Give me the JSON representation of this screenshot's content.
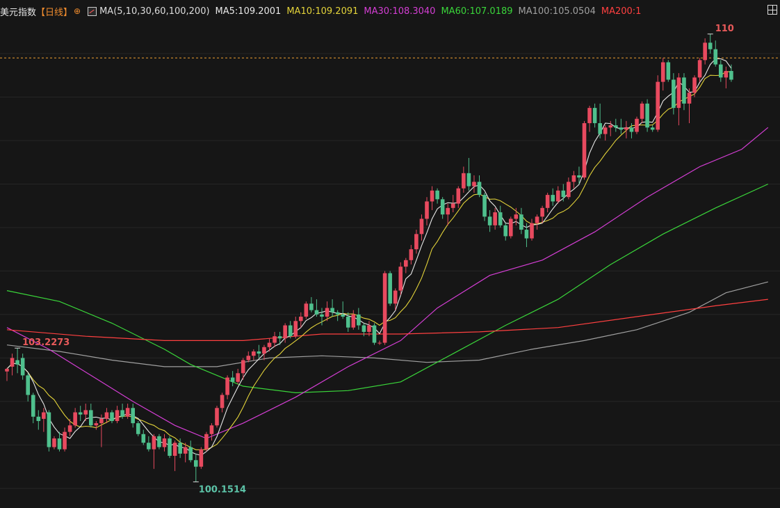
{
  "header": {
    "title": "美元指数",
    "period": "【日线】",
    "period_icon": "⊕",
    "ma_params": "MA(5,10,30,60,100,200)",
    "ma5": "MA5:109.2001",
    "ma10": "MA10:109.2091",
    "ma30": "MA30:108.3040",
    "ma60": "MA60:107.0189",
    "ma100": "MA100:105.0504",
    "ma200": "MA200:1"
  },
  "colors": {
    "background": "#161616",
    "up": "#e84a5f",
    "down": "#4fc08d",
    "ma5": "#e8e8e8",
    "ma10": "#e3d33a",
    "ma30": "#d43ed4",
    "ma60": "#3ad63a",
    "ma100": "#a0a0a0",
    "ma200": "#ff4040",
    "ref_line": "#f0a030"
  },
  "chart_data": {
    "type": "candlestick",
    "title": "美元指数 日线",
    "ylim": [
      99.55,
      110.72
    ],
    "reference_price": 109.9,
    "annotations": [
      {
        "label": "103.2273",
        "value": 103.2273,
        "kind": "high"
      },
      {
        "label": "100.1514",
        "value": 100.1514,
        "kind": "low"
      },
      {
        "label": "110",
        "value": 110.0,
        "kind": "high"
      }
    ],
    "candles": [
      [
        102.69,
        102.77,
        102.47,
        102.75
      ],
      [
        102.8,
        103.1,
        102.6,
        103.0
      ],
      [
        102.95,
        103.2273,
        102.65,
        102.85
      ],
      [
        103.0,
        103.1,
        102.5,
        102.6
      ],
      [
        102.6,
        102.65,
        102.0,
        102.15
      ],
      [
        102.15,
        102.2,
        101.5,
        101.65
      ],
      [
        101.65,
        101.8,
        101.35,
        101.55
      ],
      [
        101.6,
        101.85,
        101.3,
        101.75
      ],
      [
        101.75,
        101.8,
        100.85,
        100.95
      ],
      [
        100.95,
        101.2,
        100.9,
        101.15
      ],
      [
        101.15,
        101.3,
        100.85,
        100.9
      ],
      [
        100.9,
        101.4,
        100.85,
        101.3
      ],
      [
        101.3,
        101.6,
        101.2,
        101.45
      ],
      [
        101.45,
        101.85,
        101.4,
        101.75
      ],
      [
        101.75,
        101.9,
        101.55,
        101.7
      ],
      [
        101.7,
        101.95,
        101.55,
        101.8
      ],
      [
        101.8,
        101.95,
        101.4,
        101.45
      ],
      [
        101.45,
        101.55,
        101.35,
        101.5
      ],
      [
        101.5,
        101.7,
        100.95,
        101.6
      ],
      [
        101.6,
        101.85,
        101.5,
        101.75
      ],
      [
        101.75,
        101.8,
        101.5,
        101.55
      ],
      [
        101.55,
        101.9,
        101.5,
        101.8
      ],
      [
        101.8,
        101.95,
        101.6,
        101.65
      ],
      [
        101.65,
        101.95,
        101.6,
        101.85
      ],
      [
        101.85,
        101.95,
        101.4,
        101.5
      ],
      [
        101.5,
        101.55,
        101.2,
        101.25
      ],
      [
        101.25,
        101.35,
        101.0,
        101.05
      ],
      [
        101.05,
        101.2,
        100.85,
        100.9
      ],
      [
        100.9,
        101.25,
        100.45,
        101.2
      ],
      [
        101.2,
        101.25,
        100.9,
        100.95
      ],
      [
        100.95,
        101.25,
        100.85,
        101.15
      ],
      [
        101.15,
        101.2,
        100.7,
        100.75
      ],
      [
        100.75,
        101.1,
        100.4,
        101.05
      ],
      [
        101.05,
        101.15,
        100.7,
        100.8
      ],
      [
        100.8,
        101.05,
        100.6,
        100.95
      ],
      [
        100.95,
        101.1,
        100.6,
        100.65
      ],
      [
        100.65,
        100.8,
        100.1514,
        100.5
      ],
      [
        100.5,
        100.95,
        100.45,
        100.9
      ],
      [
        100.9,
        101.3,
        100.85,
        101.25
      ],
      [
        101.25,
        101.5,
        101.1,
        101.45
      ],
      [
        101.45,
        101.9,
        101.4,
        101.85
      ],
      [
        101.85,
        102.2,
        101.75,
        102.15
      ],
      [
        102.15,
        102.6,
        102.05,
        102.55
      ],
      [
        102.55,
        102.7,
        102.35,
        102.45
      ],
      [
        102.45,
        102.75,
        102.4,
        102.65
      ],
      [
        102.65,
        103.0,
        102.5,
        102.95
      ],
      [
        102.95,
        103.15,
        102.9,
        103.05
      ],
      [
        103.05,
        103.2,
        102.95,
        103.15
      ],
      [
        103.15,
        103.3,
        103.0,
        103.1
      ],
      [
        103.1,
        103.3,
        102.95,
        103.25
      ],
      [
        103.25,
        103.45,
        103.15,
        103.35
      ],
      [
        103.35,
        103.6,
        103.25,
        103.5
      ],
      [
        103.5,
        103.6,
        103.3,
        103.45
      ],
      [
        103.45,
        103.8,
        103.35,
        103.75
      ],
      [
        103.75,
        103.85,
        103.45,
        103.5
      ],
      [
        103.5,
        103.95,
        103.45,
        103.85
      ],
      [
        103.85,
        104.05,
        103.7,
        103.95
      ],
      [
        103.95,
        104.3,
        103.9,
        104.25
      ],
      [
        104.25,
        104.4,
        104.05,
        104.1
      ],
      [
        104.1,
        104.35,
        103.95,
        104.0
      ],
      [
        104.0,
        104.15,
        103.75,
        103.95
      ],
      [
        103.95,
        104.3,
        103.85,
        104.15
      ],
      [
        104.15,
        104.35,
        103.95,
        104.05
      ],
      [
        104.05,
        104.1,
        103.85,
        104.0
      ],
      [
        104.0,
        104.3,
        103.9,
        103.95
      ],
      [
        103.95,
        104.05,
        103.6,
        103.7
      ],
      [
        103.7,
        104.1,
        103.65,
        104.0
      ],
      [
        104.0,
        104.15,
        103.65,
        103.75
      ],
      [
        103.75,
        103.8,
        103.5,
        103.6
      ],
      [
        103.6,
        103.85,
        103.5,
        103.75
      ],
      [
        103.75,
        103.8,
        103.3,
        103.35
      ],
      [
        103.35,
        103.4,
        103.3,
        103.35
      ],
      [
        103.35,
        105.0,
        103.3,
        104.95
      ],
      [
        104.95,
        105.0,
        104.2,
        104.25
      ],
      [
        104.25,
        104.6,
        104.1,
        104.55
      ],
      [
        104.55,
        105.2,
        104.45,
        105.1
      ],
      [
        105.1,
        105.3,
        104.95,
        105.25
      ],
      [
        105.25,
        105.6,
        105.15,
        105.5
      ],
      [
        105.5,
        105.95,
        105.4,
        105.85
      ],
      [
        105.85,
        106.3,
        105.7,
        106.2
      ],
      [
        106.2,
        106.7,
        106.05,
        106.6
      ],
      [
        106.6,
        106.95,
        106.4,
        106.85
      ],
      [
        106.85,
        106.9,
        106.55,
        106.65
      ],
      [
        106.65,
        106.7,
        106.2,
        106.3
      ],
      [
        106.3,
        106.55,
        106.05,
        106.45
      ],
      [
        106.45,
        106.75,
        106.35,
        106.55
      ],
      [
        106.55,
        106.95,
        106.45,
        106.9
      ],
      [
        106.9,
        107.4,
        106.8,
        107.25
      ],
      [
        107.25,
        107.6,
        106.85,
        106.95
      ],
      [
        106.95,
        107.2,
        106.8,
        107.05
      ],
      [
        107.05,
        107.2,
        106.7,
        106.75
      ],
      [
        106.75,
        106.8,
        106.15,
        106.25
      ],
      [
        106.25,
        106.4,
        105.9,
        106.05
      ],
      [
        106.05,
        106.45,
        105.95,
        106.35
      ],
      [
        106.35,
        106.5,
        106.0,
        106.05
      ],
      [
        106.05,
        106.1,
        105.7,
        105.8
      ],
      [
        105.8,
        106.25,
        105.75,
        106.2
      ],
      [
        106.2,
        106.45,
        106.05,
        106.3
      ],
      [
        106.3,
        106.45,
        105.85,
        105.95
      ],
      [
        105.95,
        106.1,
        105.55,
        105.75
      ],
      [
        105.75,
        106.2,
        105.7,
        106.1
      ],
      [
        106.1,
        106.3,
        105.95,
        106.25
      ],
      [
        106.25,
        106.5,
        106.1,
        106.45
      ],
      [
        106.45,
        106.8,
        106.35,
        106.75
      ],
      [
        106.75,
        106.9,
        106.5,
        106.6
      ],
      [
        106.6,
        106.95,
        106.55,
        106.85
      ],
      [
        106.85,
        107.0,
        106.6,
        106.7
      ],
      [
        106.7,
        107.15,
        106.65,
        107.05
      ],
      [
        107.05,
        107.3,
        106.9,
        107.2
      ],
      [
        107.2,
        107.4,
        107.0,
        107.15
      ],
      [
        107.15,
        108.45,
        107.1,
        108.4
      ],
      [
        108.4,
        108.8,
        108.2,
        108.75
      ],
      [
        108.75,
        108.85,
        108.3,
        108.4
      ],
      [
        108.4,
        108.85,
        108.05,
        108.15
      ],
      [
        108.15,
        108.35,
        108.0,
        108.3
      ],
      [
        108.3,
        108.45,
        108.1,
        108.35
      ],
      [
        108.35,
        108.5,
        108.2,
        108.3
      ],
      [
        108.3,
        108.5,
        108.15,
        108.25
      ],
      [
        108.25,
        108.45,
        108.05,
        108.3
      ],
      [
        108.3,
        108.4,
        108.05,
        108.2
      ],
      [
        108.2,
        108.55,
        108.15,
        108.5
      ],
      [
        108.5,
        108.9,
        108.4,
        108.85
      ],
      [
        108.85,
        108.95,
        108.2,
        108.3
      ],
      [
        108.3,
        108.35,
        108.2,
        108.25
      ],
      [
        108.25,
        109.5,
        108.2,
        109.35
      ],
      [
        109.35,
        109.9,
        109.15,
        109.8
      ],
      [
        109.8,
        109.85,
        109.35,
        109.4
      ],
      [
        109.4,
        109.55,
        108.6,
        108.75
      ],
      [
        108.75,
        109.55,
        108.35,
        109.45
      ],
      [
        109.45,
        109.55,
        108.7,
        108.85
      ],
      [
        108.85,
        109.2,
        108.4,
        109.1
      ],
      [
        109.1,
        109.5,
        109.0,
        109.45
      ],
      [
        109.45,
        109.9,
        109.35,
        109.85
      ],
      [
        109.85,
        110.35,
        109.75,
        110.25
      ],
      [
        110.25,
        110.45,
        110.0,
        110.1
      ],
      [
        110.1,
        110.3,
        109.7,
        109.75
      ],
      [
        109.75,
        109.85,
        109.35,
        109.45
      ],
      [
        109.45,
        109.7,
        109.2,
        109.6
      ],
      [
        109.6,
        109.75,
        109.35,
        109.4
      ]
    ],
    "ma_series": [
      {
        "name": "MA100",
        "points": [
          [
            0,
            103.3
          ],
          [
            10,
            103.15
          ],
          [
            20,
            102.95
          ],
          [
            30,
            102.8
          ],
          [
            40,
            102.8
          ],
          [
            50,
            103.0
          ],
          [
            60,
            103.05
          ],
          [
            70,
            103.0
          ],
          [
            80,
            102.9
          ],
          [
            90,
            102.95
          ],
          [
            100,
            103.2
          ],
          [
            110,
            103.4
          ],
          [
            120,
            103.65
          ],
          [
            130,
            104.05
          ],
          [
            137,
            104.5
          ],
          [
            145,
            104.75
          ]
        ]
      },
      {
        "name": "MA60",
        "points": [
          [
            0,
            104.55
          ],
          [
            10,
            104.3
          ],
          [
            20,
            103.8
          ],
          [
            30,
            103.2
          ],
          [
            35,
            102.85
          ],
          [
            45,
            102.35
          ],
          [
            55,
            102.2
          ],
          [
            65,
            102.25
          ],
          [
            75,
            102.45
          ],
          [
            85,
            103.1
          ],
          [
            95,
            103.75
          ],
          [
            105,
            104.35
          ],
          [
            115,
            105.15
          ],
          [
            125,
            105.85
          ],
          [
            135,
            106.45
          ],
          [
            145,
            107.0
          ]
        ]
      },
      {
        "name": "MA30",
        "points": [
          [
            0,
            103.7
          ],
          [
            8,
            103.2
          ],
          [
            16,
            102.6
          ],
          [
            24,
            102.0
          ],
          [
            32,
            101.45
          ],
          [
            38,
            101.15
          ],
          [
            45,
            101.5
          ],
          [
            55,
            102.1
          ],
          [
            65,
            102.8
          ],
          [
            75,
            103.4
          ],
          [
            82,
            104.15
          ],
          [
            92,
            104.9
          ],
          [
            102,
            105.25
          ],
          [
            112,
            105.9
          ],
          [
            122,
            106.7
          ],
          [
            132,
            107.4
          ],
          [
            140,
            107.8
          ],
          [
            145,
            108.3
          ]
        ]
      },
      {
        "name": "MA200",
        "points": [
          [
            0,
            103.65
          ],
          [
            15,
            103.5
          ],
          [
            30,
            103.4
          ],
          [
            45,
            103.4
          ],
          [
            60,
            103.55
          ],
          [
            75,
            103.55
          ],
          [
            90,
            103.6
          ],
          [
            105,
            103.7
          ],
          [
            120,
            103.95
          ],
          [
            135,
            104.2
          ],
          [
            145,
            104.35
          ]
        ]
      }
    ]
  }
}
